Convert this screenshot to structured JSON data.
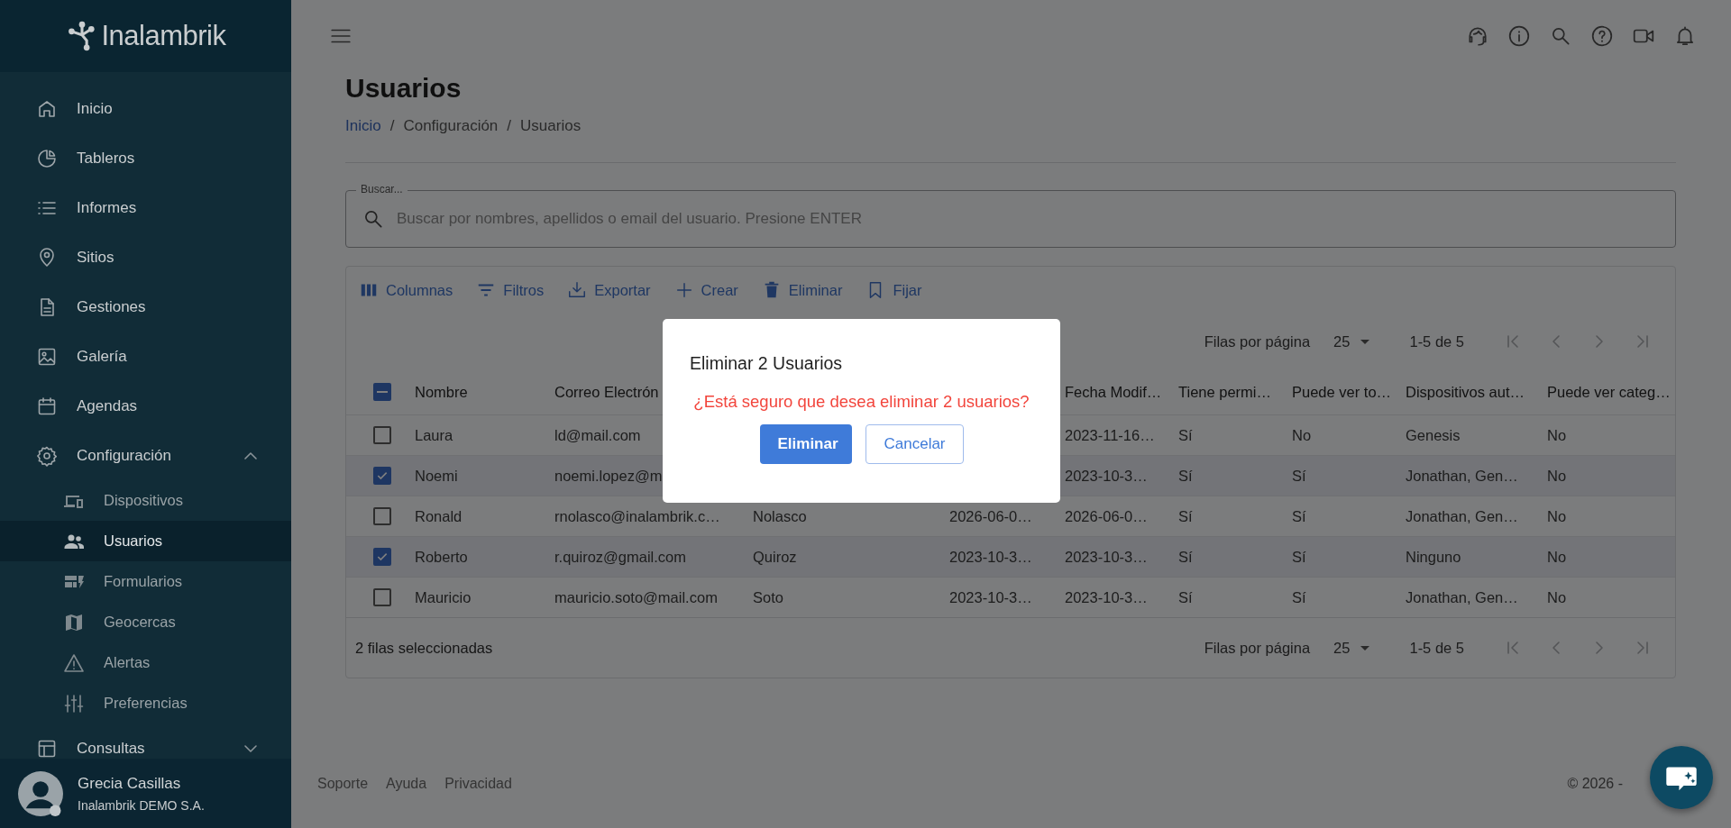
{
  "sidebar": {
    "logo": "Inalambrik",
    "items": [
      {
        "label": "Inicio",
        "selected": false
      },
      {
        "label": "Tableros",
        "selected": false
      },
      {
        "label": "Informes",
        "selected": false
      },
      {
        "label": "Sitios",
        "selected": false
      },
      {
        "label": "Gestiones",
        "selected": false
      },
      {
        "label": "Galería",
        "selected": false
      },
      {
        "label": "Agendas",
        "selected": false
      },
      {
        "label": "Configuración",
        "selected": false,
        "expanded": true,
        "children": [
          {
            "label": "Dispositivos",
            "selected": false
          },
          {
            "label": "Usuarios",
            "selected": true
          },
          {
            "label": "Formularios",
            "selected": false
          },
          {
            "label": "Geocercas",
            "selected": false
          },
          {
            "label": "Alertas",
            "selected": false
          },
          {
            "label": "Preferencias",
            "selected": false
          }
        ]
      },
      {
        "label": "Consultas",
        "selected": false,
        "expanded": false
      }
    ],
    "user": {
      "name": "Grecia Casillas",
      "organization": "Inalambrik DEMO S.A."
    }
  },
  "page": {
    "title": "Usuarios",
    "breadcrumb": [
      {
        "label": "Inicio",
        "kind": "link"
      },
      {
        "label": "/",
        "kind": "separator"
      },
      {
        "label": "Configuración",
        "kind": "text"
      },
      {
        "label": "/",
        "kind": "separator"
      },
      {
        "label": "Usuarios",
        "kind": "text"
      }
    ]
  },
  "search": {
    "label": "Buscar...",
    "placeholder": "Buscar por nombres, apellidos o email del usuario. Presione ENTER"
  },
  "toolbar": [
    "Columnas",
    "Filtros",
    "Exportar",
    "Crear",
    "Eliminar",
    "Fijar"
  ],
  "table": {
    "pagination_top": {
      "rows_per_page_label": "Filas por página",
      "rows_per_page": "25",
      "range": "1-5 de 5"
    },
    "header_checkbox": {
      "indeterminate": true
    },
    "columns": [
      "Nombre",
      "Correo Electrón",
      null,
      null,
      "Fecha Modif…",
      "Tiene permi…",
      "Puede ver to…",
      "Dispositivos aut…",
      "Puede ver categ…"
    ],
    "rows": [
      {
        "selected": false,
        "cells": [
          "Laura",
          "ld@mail.com",
          null,
          null,
          "2023-11-16…",
          "Sí",
          "No",
          "Genesis",
          "No"
        ]
      },
      {
        "selected": true,
        "cells": [
          "Noemi",
          "noemi.lopez@m",
          null,
          null,
          "2023-10-3…",
          "Sí",
          "Sí",
          "Jonathan, Gen…",
          "No"
        ]
      },
      {
        "selected": false,
        "cells": [
          "Ronald",
          "rnolasco@inalambrik.c…",
          "Nolasco",
          "2026-06-0…",
          "2026-06-0…",
          "Sí",
          "Sí",
          "Jonathan, Gen…",
          "No"
        ]
      },
      {
        "selected": true,
        "cells": [
          "Roberto",
          "r.quiroz@gmail.com",
          "Quiroz",
          "2023-10-3…",
          "2023-10-3…",
          "Sí",
          "Sí",
          "Ninguno",
          "No"
        ]
      },
      {
        "selected": false,
        "cells": [
          "Mauricio",
          "mauricio.soto@mail.com",
          "Soto",
          "2023-10-3…",
          "2023-10-3…",
          "Sí",
          "Sí",
          "Jonathan, Gen…",
          "No"
        ]
      }
    ],
    "footer": {
      "selected_count": "2 filas seleccionadas",
      "pagination": {
        "rows_per_page_label": "Filas por página",
        "rows_per_page": "25",
        "range": "1-5 de 5"
      }
    }
  },
  "footer": {
    "links": [
      "Soporte",
      "Ayuda",
      "Privacidad"
    ],
    "copyright": "© 2026 -"
  },
  "dialog": {
    "title": "Eliminar 2 Usuarios",
    "message": "¿Está seguro que desea eliminar 2 usuarios?",
    "buttons": [
      {
        "label": "Eliminar",
        "kind": "primary"
      },
      {
        "label": "Cancelar",
        "kind": "secondary"
      }
    ]
  }
}
